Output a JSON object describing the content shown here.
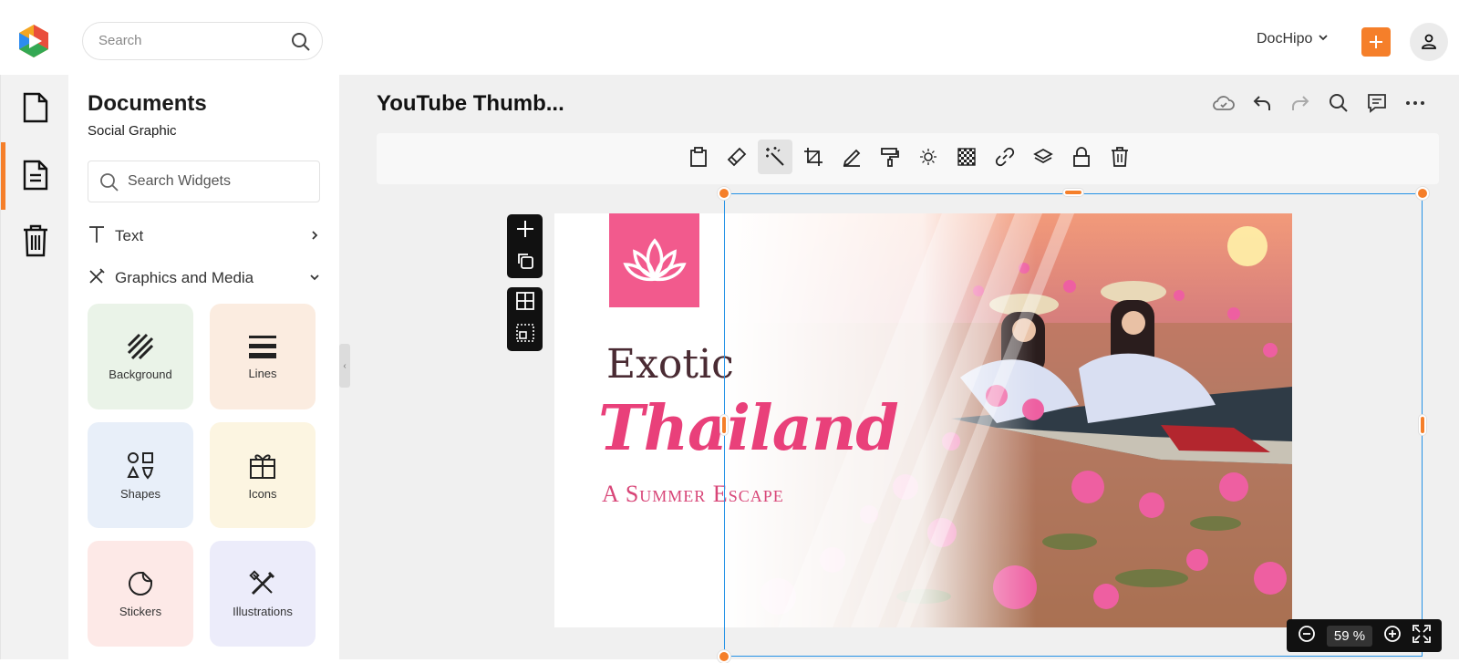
{
  "header": {
    "search_placeholder": "Search",
    "brand": "DocHipo"
  },
  "sidebar": {
    "items": [
      {
        "icon": "document-icon"
      },
      {
        "icon": "document-lines-icon",
        "active": true
      },
      {
        "icon": "trash-icon"
      }
    ]
  },
  "panel": {
    "title": "Documents",
    "subtitle": "Social Graphic",
    "search_placeholder": "Search Widgets",
    "sections": [
      {
        "label": "Text",
        "icon": "text-icon"
      },
      {
        "label": "Graphics and Media",
        "icon": "graphics-icon"
      }
    ],
    "tiles": [
      {
        "label": "Background",
        "color": "#eaf3e8"
      },
      {
        "label": "Lines",
        "color": "#fbece0"
      },
      {
        "label": "Shapes",
        "color": "#e8eff9"
      },
      {
        "label": "Icons",
        "color": "#fcf5e1"
      },
      {
        "label": "Stickers",
        "color": "#fde9e7"
      },
      {
        "label": "Illustrations",
        "color": "#ececfa"
      }
    ]
  },
  "editor": {
    "doc_title": "YouTube Thumb...",
    "zoom": "59 %"
  },
  "design": {
    "title_1": "Exotic",
    "title_2": "Thailand",
    "subtitle": "A Summer Escape",
    "accent": "#f25a8d"
  },
  "colors": {
    "brand_orange": "#f57f2a",
    "selection_blue": "#2592e6"
  }
}
